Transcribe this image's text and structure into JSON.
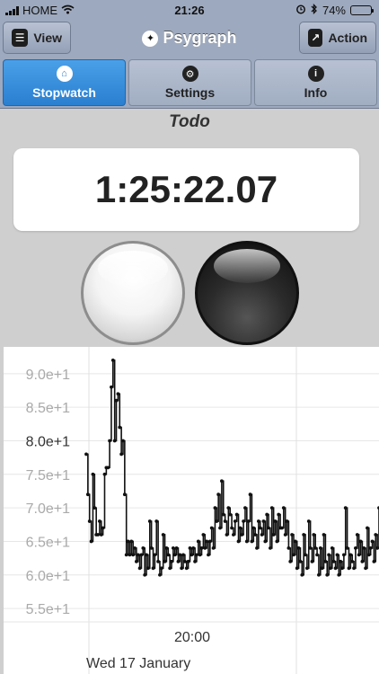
{
  "status_bar": {
    "carrier": "HOME",
    "time": "21:26",
    "battery_percent": "74%",
    "battery_level": 0.74
  },
  "toolbar": {
    "view_label": "View",
    "app_title": "Psygraph",
    "action_label": "Action"
  },
  "tabs": [
    {
      "label": "Stopwatch",
      "icon": "home-icon",
      "active": true
    },
    {
      "label": "Settings",
      "icon": "gear-icon",
      "active": false
    },
    {
      "label": "Info",
      "icon": "info-icon",
      "active": false
    }
  ],
  "main": {
    "subtitle": "Todo",
    "timer": "1:25:22.07"
  },
  "colors": {
    "bar_bg": "#9da9be",
    "active_tab": "#2a7fd0",
    "page_bg": "#cfcfcf"
  },
  "chart_data": {
    "type": "line",
    "y_tick_labels": [
      "9.0e+1",
      "8.5e+1",
      "8.0e+1",
      "7.5e+1",
      "7.0e+1",
      "6.5e+1",
      "6.0e+1",
      "5.5e+1"
    ],
    "y_ticks": [
      90,
      85,
      80,
      75,
      70,
      65,
      60,
      55
    ],
    "ylim": [
      53,
      94
    ],
    "x_tick_label": "20:00",
    "x_sub_label": "Wed 17 January",
    "grid": true,
    "series": [
      {
        "values": [
          78,
          72,
          68,
          65,
          75,
          70,
          66,
          66,
          68,
          66,
          67,
          75,
          76,
          76,
          80,
          88,
          92,
          80,
          86,
          87,
          82,
          78,
          80,
          72,
          63,
          65,
          63,
          65,
          63,
          64,
          62,
          63,
          61,
          63,
          64,
          60,
          63,
          61,
          68,
          64,
          61,
          63,
          68,
          62,
          60,
          61,
          66,
          62,
          64,
          63,
          61,
          62,
          64,
          63,
          64,
          62,
          63,
          61,
          63,
          62,
          61,
          62,
          64,
          63,
          64,
          62,
          63,
          65,
          63,
          64,
          66,
          64,
          65,
          63,
          65,
          67,
          64,
          70,
          68,
          72,
          67,
          74,
          69,
          68,
          66,
          70,
          69,
          67,
          66,
          68,
          69,
          65,
          67,
          66,
          68,
          70,
          65,
          68,
          72,
          65,
          67,
          66,
          64,
          68,
          67,
          66,
          68,
          65,
          69,
          67,
          64,
          70,
          66,
          68,
          65,
          69,
          67,
          67,
          70,
          66,
          68,
          64,
          62,
          66,
          63,
          65,
          61,
          64,
          62,
          60,
          66,
          63,
          61,
          68,
          64,
          62,
          66,
          64,
          63,
          60,
          64,
          61,
          66,
          62,
          60,
          63,
          61,
          64,
          62,
          61,
          63,
          60,
          62,
          61,
          63,
          70,
          64,
          61,
          63,
          62,
          61,
          64,
          66,
          63,
          65,
          62,
          64,
          61,
          67,
          63,
          64,
          65,
          62,
          66,
          64,
          70
        ]
      }
    ]
  }
}
